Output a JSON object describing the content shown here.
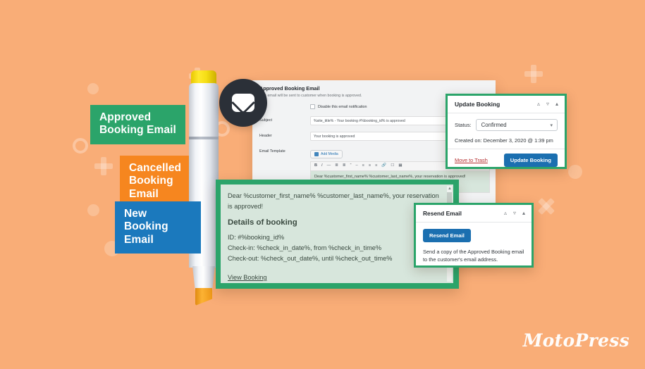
{
  "theme": {
    "background": "#f9ad77",
    "green": "#2ba46a",
    "orange": "#f6861f",
    "blue": "#1b79bd",
    "wp_blue": "#1b6fb0",
    "preview_bg": "#d7e6dc",
    "dark": "#2b3038"
  },
  "tags": [
    {
      "id": "approved",
      "label": "Approved Booking Email",
      "color": "#2ba46a"
    },
    {
      "id": "cancelled",
      "label": "Cancelled Booking Email",
      "color": "#f6861f"
    },
    {
      "id": "new",
      "label": "New Booking Email",
      "color": "#1b79bd"
    }
  ],
  "mail_badge": {
    "icon": "envelope-icon"
  },
  "settings_panel": {
    "title": "Approved Booking Email",
    "description": "This email will be sent to customer when booking is approved.",
    "disable_checkbox_label": "Disable this email notification",
    "fields": [
      {
        "label": "Subject",
        "value": "%site_title% - Your booking #%booking_id% is approved"
      },
      {
        "label": "Header",
        "value": "Your booking is approved"
      }
    ],
    "template_label": "Email Template",
    "add_media_label": "Add Media",
    "toolbar_items": [
      "B",
      "I",
      "ABC",
      "UL",
      "OL",
      "“",
      "—",
      "L",
      "C",
      "R",
      "link",
      "unlink",
      "more"
    ],
    "editor_text": "Dear %customer_first_name% %customer_last_name%, your reservation is approved!"
  },
  "preview": {
    "lead": "Dear %customer_first_name% %customer_last_name%, your reservation is approved!",
    "heading": "Details of booking",
    "lines": [
      "ID: #%booking_id%",
      "Check-in: %check_in_date%, from %check_in_time%",
      "Check-out: %check_out_date%, until %check_out_time%"
    ],
    "link": "View Booking"
  },
  "update_booking": {
    "title": "Update Booking",
    "status_label": "Status:",
    "status_value": "Confirmed",
    "created_on": "Created on: December 3, 2020 @ 1:39 pm",
    "trash_label": "Move to Trash",
    "submit_label": "Update Booking"
  },
  "resend_email": {
    "title": "Resend Email",
    "button_label": "Resend Email",
    "description": "Send a copy of the Approved Booking email to the customer's email address."
  },
  "logo": {
    "text": "MotoPress"
  }
}
